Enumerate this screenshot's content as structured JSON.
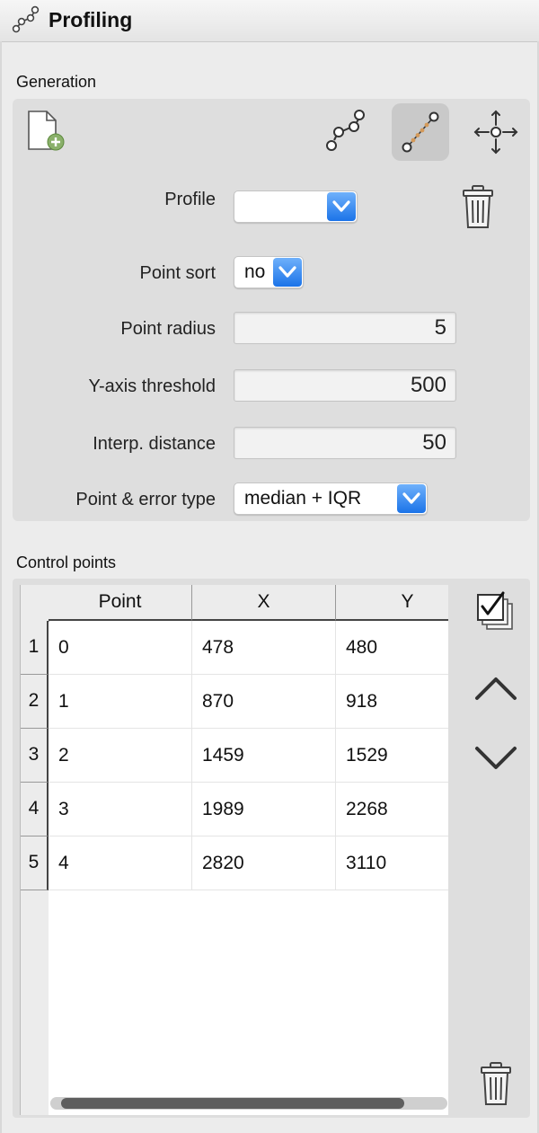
{
  "window": {
    "title": "Profiling"
  },
  "generation": {
    "label": "Generation",
    "tools": {
      "new_profile": "new-profile-icon",
      "profile_line": "profile-line-icon",
      "profile_spline": "profile-spline-icon",
      "move": "move-icon"
    },
    "profile": {
      "label": "Profile",
      "value": ""
    },
    "point_sort": {
      "label": "Point sort",
      "value": "no"
    },
    "point_radius": {
      "label": "Point radius",
      "value": "5"
    },
    "y_axis_threshold": {
      "label": "Y-axis threshold",
      "value": "500"
    },
    "interp_distance": {
      "label": "Interp. distance",
      "value": "50"
    },
    "point_error_type": {
      "label": "Point & error type",
      "value": "median + IQR"
    }
  },
  "control_points": {
    "label": "Control points",
    "columns": [
      "Point",
      "X",
      "Y"
    ],
    "rows": [
      {
        "index": "1",
        "point": "0",
        "x": "478",
        "y": "480"
      },
      {
        "index": "2",
        "point": "1",
        "x": "870",
        "y": "918"
      },
      {
        "index": "3",
        "point": "2",
        "x": "1459",
        "y": "1529"
      },
      {
        "index": "4",
        "point": "3",
        "x": "1989",
        "y": "2268"
      },
      {
        "index": "5",
        "point": "4",
        "x": "2820",
        "y": "3110"
      }
    ]
  },
  "colors": {
    "accent": "#1b73e8",
    "panel": "#dedede",
    "spline_dots": "#d49a5a"
  }
}
